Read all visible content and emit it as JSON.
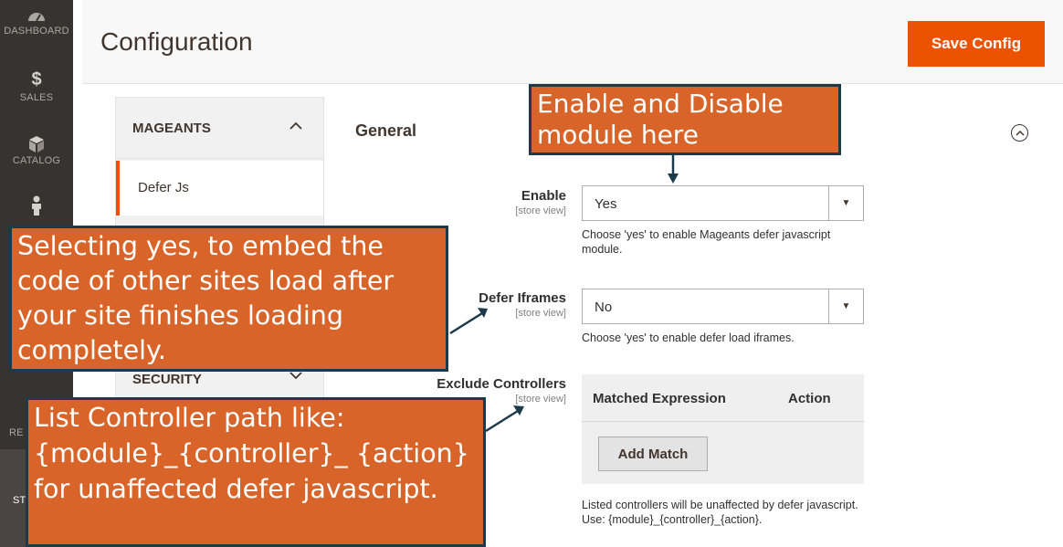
{
  "nav": {
    "items": [
      {
        "label": "DASHBOARD",
        "icon": "dashboard-icon"
      },
      {
        "label": "SALES",
        "icon": "dollar-icon"
      },
      {
        "label": "CATALOG",
        "icon": "cube-icon"
      },
      {
        "label": "",
        "icon": "person-icon"
      }
    ],
    "partial_labels": {
      "re": "RE",
      "st": "ST"
    }
  },
  "header": {
    "title": "Configuration",
    "save_label": "Save Config"
  },
  "config_tabs": {
    "group1": "MAGEANTS",
    "active_item": "Defer Js",
    "group2": "SECURITY"
  },
  "section": {
    "title": "General",
    "fields": {
      "enable": {
        "label": "Enable",
        "scope": "[store view]",
        "value": "Yes",
        "note": "Choose 'yes' to enable Mageants defer javascript module."
      },
      "defer_iframes": {
        "label": "Defer Iframes",
        "scope": "[store view]",
        "value": "No",
        "note": "Choose 'yes' to enable defer load iframes."
      },
      "exclude_controllers": {
        "label": "Exclude Controllers",
        "scope": "[store view]",
        "col_expression": "Matched Expression",
        "col_action": "Action",
        "add_label": "Add Match",
        "note": "Listed controllers will be unaffected by defer javascript. Use: {module}_{controller}_{action}."
      }
    }
  },
  "callouts": {
    "c1": "Enable and Disable module here",
    "c2": "Selecting yes, to embed the code of other sites load after your site finishes loading completely.",
    "c3": "List Controller path like: {module}_{controller}_ {action} for unaffected defer javascript."
  },
  "colors": {
    "accent": "#eb5202",
    "callout": "#d9642a",
    "callout_border": "#1c3a4a",
    "nav": "#373330"
  }
}
